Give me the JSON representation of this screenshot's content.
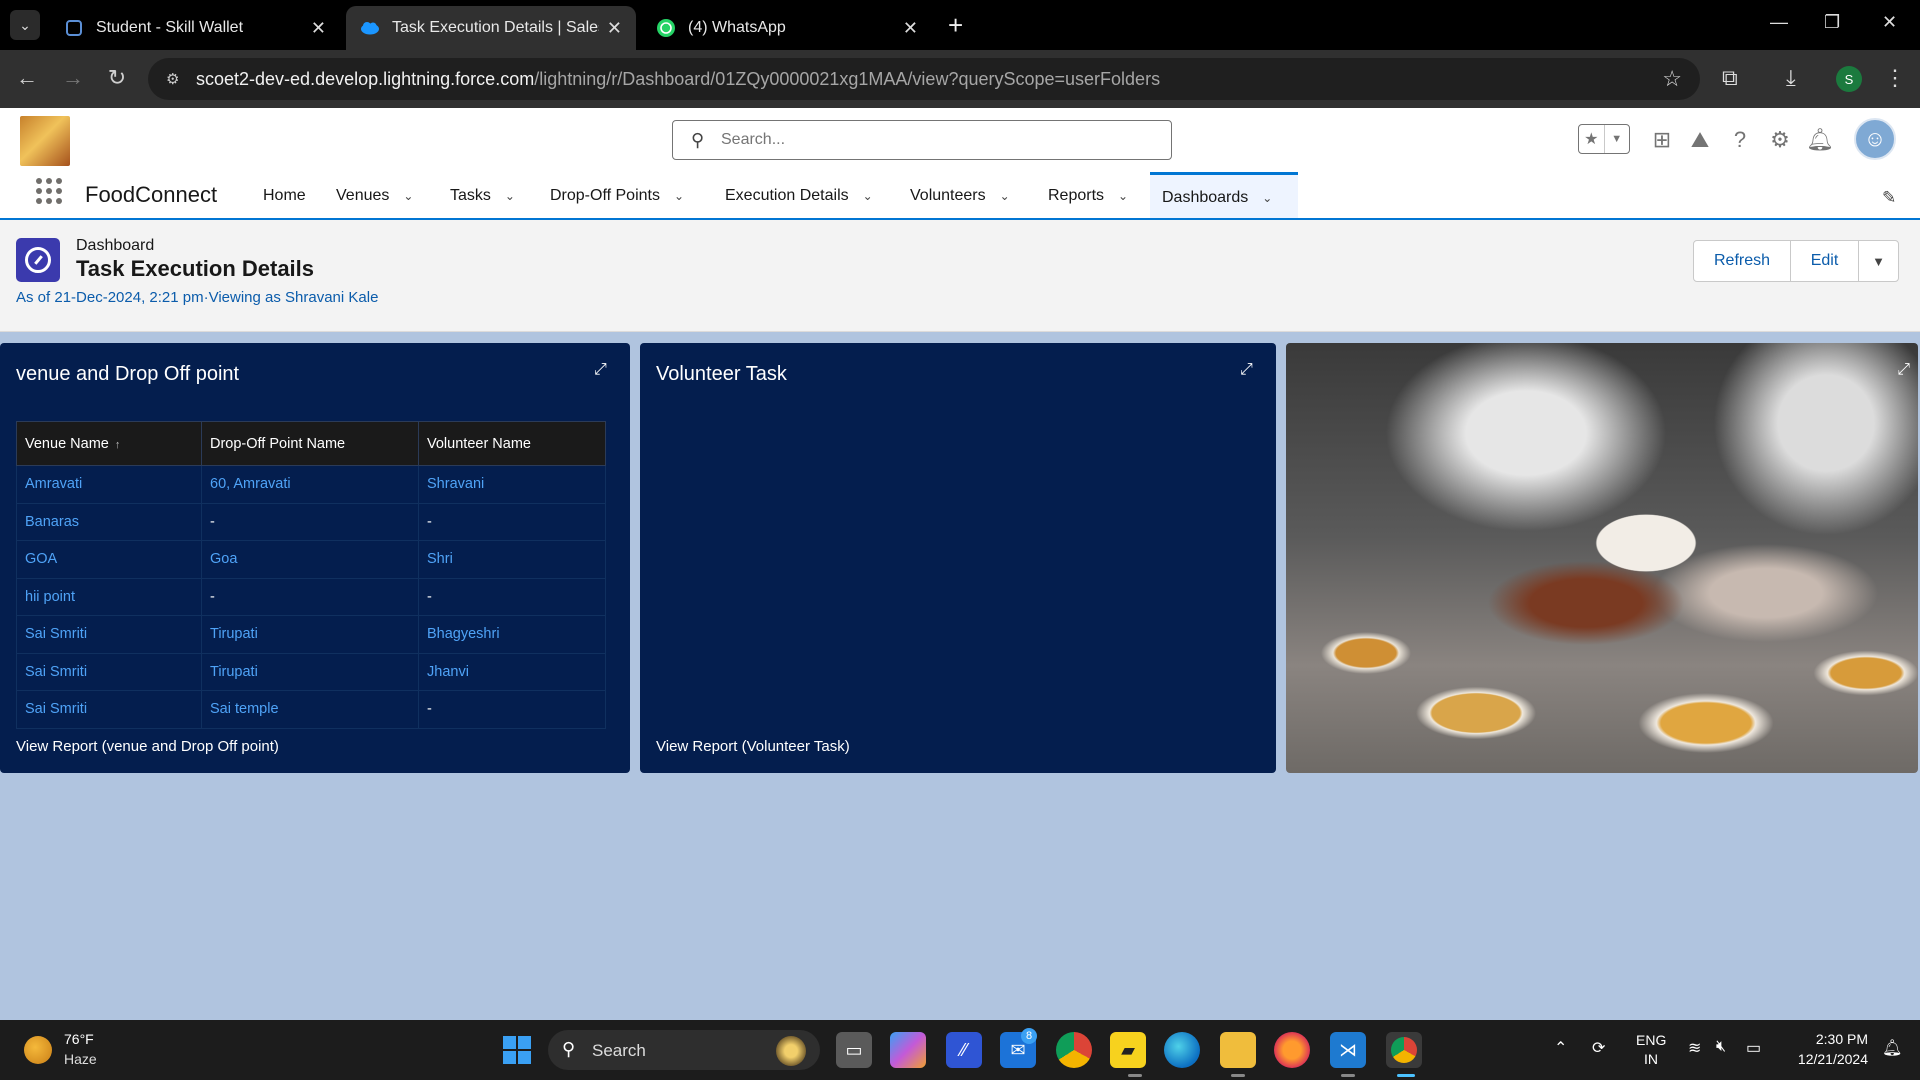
{
  "browser": {
    "tabs": [
      {
        "title": "Student - Skill Wallet",
        "active": false
      },
      {
        "title": "Task Execution Details | Salesfor",
        "active": true
      },
      {
        "title": "(4) WhatsApp",
        "active": false
      }
    ],
    "url_host": "scoet2-dev-ed.develop.lightning.force.com",
    "url_path": "/lightning/r/Dashboard/01ZQy0000021xg1MAA/view?queryScope=userFolders",
    "profile_initial": "S"
  },
  "sf": {
    "search_placeholder": "Search...",
    "app_name": "FoodConnect",
    "nav": [
      {
        "label": "Home",
        "has_menu": false
      },
      {
        "label": "Venues",
        "has_menu": true
      },
      {
        "label": "Tasks",
        "has_menu": true
      },
      {
        "label": "Drop-Off Points",
        "has_menu": true
      },
      {
        "label": "Execution Details",
        "has_menu": true
      },
      {
        "label": "Volunteers",
        "has_menu": true
      },
      {
        "label": "Reports",
        "has_menu": true
      },
      {
        "label": "Dashboards",
        "has_menu": true,
        "active": true
      }
    ],
    "accent": "#0176d3"
  },
  "dashboard": {
    "eyebrow": "Dashboard",
    "title": "Task Execution Details",
    "as_of": "As of 21-Dec-2024, 2:21 pm·Viewing as Shravani Kale",
    "buttons": {
      "refresh": "Refresh",
      "edit": "Edit"
    },
    "tiles": {
      "venue": {
        "title": "venue and Drop Off point",
        "columns": [
          "Venue Name",
          "Drop-Off Point Name",
          "Volunteer Name"
        ],
        "rows": [
          [
            "Amravati",
            "60, Amravati",
            "Shravani"
          ],
          [
            "Banaras",
            "-",
            "-"
          ],
          [
            "GOA",
            "Goa",
            "Shri"
          ],
          [
            "hii point",
            "-",
            "-"
          ],
          [
            "Sai Smriti",
            "Tirupati",
            "Bhagyeshri"
          ],
          [
            "Sai Smriti",
            "Tirupati",
            "Jhanvi"
          ],
          [
            "Sai Smriti",
            "Sai temple",
            "-"
          ]
        ],
        "view_report": "View Report (venue and Drop Off point)"
      },
      "volunteer": {
        "title": "Volunteer Task",
        "view_report": "View Report (Volunteer Task)"
      }
    },
    "tile_bg": "#041e4e",
    "link_color": "#4fa3f7"
  },
  "taskbar": {
    "temp": "76°F",
    "weather": "Haze",
    "search_label": "Search",
    "mail_badge": "8",
    "lang1": "ENG",
    "lang2": "IN",
    "time": "2:30 PM",
    "date": "12/21/2024"
  }
}
